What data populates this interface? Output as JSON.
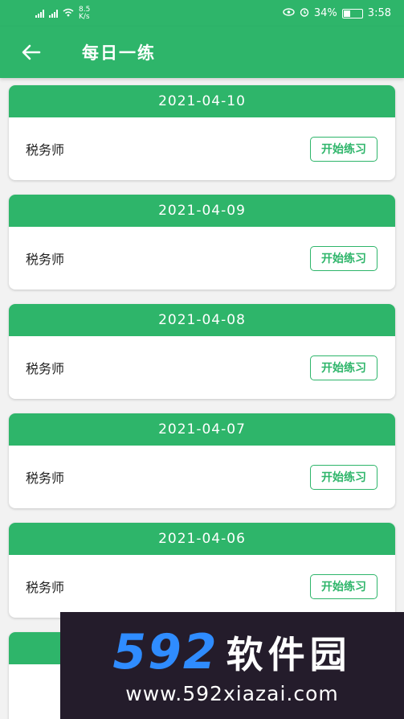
{
  "status_bar": {
    "left_text": "8.5 K/s",
    "battery": "34%",
    "time": "3:58",
    "battery_level": 0.34
  },
  "app_bar": {
    "back_icon": "arrow-left-icon",
    "title": "每日一练"
  },
  "cards": [
    {
      "date": "2021-04-10",
      "label": "税务师",
      "button": "开始练习"
    },
    {
      "date": "2021-04-09",
      "label": "税务师",
      "button": "开始练习"
    },
    {
      "date": "2021-04-08",
      "label": "税务师",
      "button": "开始练习"
    },
    {
      "date": "2021-04-07",
      "label": "税务师",
      "button": "开始练习"
    },
    {
      "date": "2021-04-06",
      "label": "税务师",
      "button": "开始练习"
    },
    {
      "date": "",
      "label": "",
      "button": ""
    }
  ],
  "watermark": {
    "digits": "592",
    "name": "软件园",
    "url": "www.592xiazai.com"
  },
  "colors": {
    "primary": "#2eb56a",
    "background": "#f2f2f2",
    "watermark_bg": "#241c2b",
    "watermark_blue": "#2f8cff"
  }
}
